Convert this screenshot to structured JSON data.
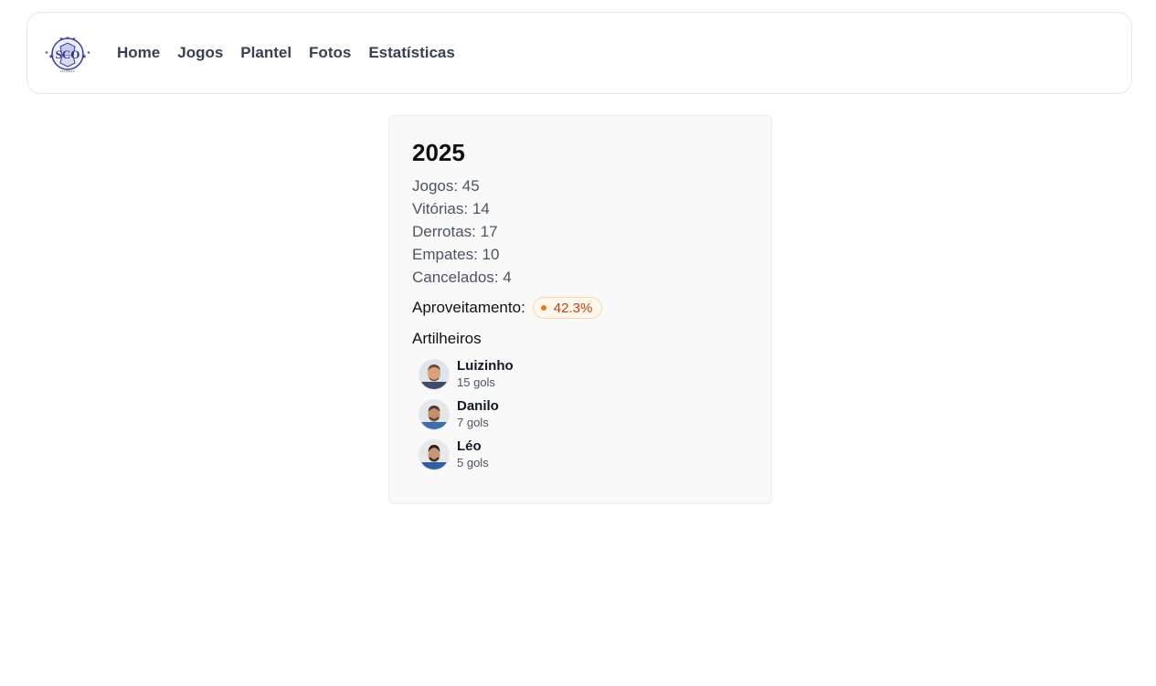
{
  "nav": {
    "logo_text": "SCO",
    "links": [
      "Home",
      "Jogos",
      "Plantel",
      "Fotos",
      "Estatísticas"
    ]
  },
  "season": {
    "year": "2025",
    "stats": [
      "Jogos: 45",
      "Vitórias: 14",
      "Derrotas: 17",
      "Empates: 10",
      "Cancelados: 4"
    ],
    "aproveitamento_label": "Aproveitamento:",
    "aproveitamento_value": "42.3%",
    "artilheiros_title": "Artilheiros",
    "scorers": [
      {
        "name": "Luizinho",
        "goals": "15 gols"
      },
      {
        "name": "Danilo",
        "goals": "7 gols"
      },
      {
        "name": "Léo",
        "goals": "5 gols"
      }
    ]
  },
  "colors": {
    "badge_text": "#c2410c",
    "badge_dot": "#f97316",
    "logo_blue": "#3b3fa0"
  }
}
